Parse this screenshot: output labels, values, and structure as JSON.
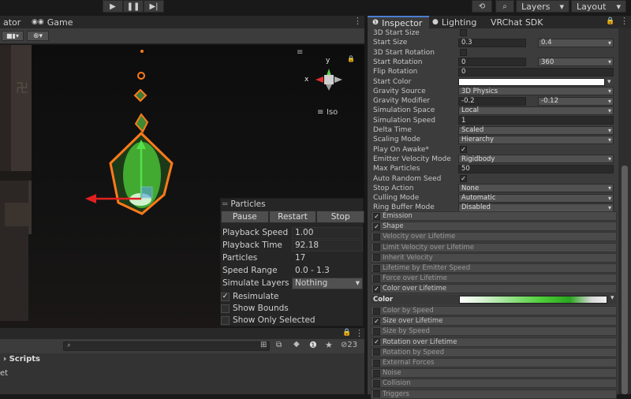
{
  "toolbar": {
    "layers_label": "Layers",
    "layout_label": "Layout"
  },
  "scene_tabs": {
    "animator": "ator",
    "game": "Game"
  },
  "gizmo": {
    "x_label": "x",
    "y_label": "y",
    "iso_label": "Iso"
  },
  "particles_overlay": {
    "title": "Particles",
    "pause": "Pause",
    "restart": "Restart",
    "stop": "Stop",
    "playback_speed_label": "Playback Speed",
    "playback_speed_value": "1.00",
    "playback_time_label": "Playback Time",
    "playback_time_value": "92.18",
    "particles_label": "Particles",
    "particles_value": "17",
    "speed_range_label": "Speed Range",
    "speed_range_value": "0.0 - 1.3",
    "simulate_layers_label": "Simulate Layers",
    "simulate_layers_value": "Nothing",
    "resimulate_label": "Resimulate",
    "show_bounds_label": "Show Bounds",
    "show_only_selected_label": "Show Only Selected"
  },
  "project": {
    "scripts_label": "Scripts",
    "asset_label": "et",
    "hidden_count": "23"
  },
  "inspector_tabs": {
    "inspector": "Inspector",
    "lighting": "Lighting",
    "vrchat": "VRChat SDK"
  },
  "properties": [
    {
      "label": "3D Start Size",
      "kind": "checkbox",
      "checked": false
    },
    {
      "label": "Start Size",
      "kind": "two",
      "a": "0.3",
      "b": "0.4"
    },
    {
      "label": "3D Start Rotation",
      "kind": "checkbox",
      "checked": false
    },
    {
      "label": "Start Rotation",
      "kind": "two",
      "a": "0",
      "b": "360"
    },
    {
      "label": "Flip Rotation",
      "kind": "field",
      "a": "0"
    },
    {
      "label": "Start Color",
      "kind": "color"
    },
    {
      "label": "Gravity Source",
      "kind": "drop",
      "a": "3D Physics"
    },
    {
      "label": "Gravity Modifier",
      "kind": "two",
      "a": "-0.2",
      "b": "-0.12"
    },
    {
      "label": "Simulation Space",
      "kind": "drop",
      "a": "Local"
    },
    {
      "label": "Simulation Speed",
      "kind": "field",
      "a": "1"
    },
    {
      "label": "Delta Time",
      "kind": "drop",
      "a": "Scaled"
    },
    {
      "label": "Scaling Mode",
      "kind": "drop",
      "a": "Hierarchy"
    },
    {
      "label": "Play On Awake*",
      "kind": "checkbox",
      "checked": true
    },
    {
      "label": "Emitter Velocity Mode",
      "kind": "drop",
      "a": "Rigidbody"
    },
    {
      "label": "Max Particles",
      "kind": "field",
      "a": "50"
    },
    {
      "label": "Auto Random Seed",
      "kind": "checkbox",
      "checked": true
    },
    {
      "label": "Stop Action",
      "kind": "drop",
      "a": "None"
    },
    {
      "label": "Culling Mode",
      "kind": "drop",
      "a": "Automatic"
    },
    {
      "label": "Ring Buffer Mode",
      "kind": "drop",
      "a": "Disabled"
    }
  ],
  "modules_a": [
    {
      "label": "Emission",
      "checked": true
    },
    {
      "label": "Shape",
      "checked": true
    },
    {
      "label": "Velocity over Lifetime",
      "checked": false
    },
    {
      "label": "Limit Velocity over Lifetime",
      "checked": false
    },
    {
      "label": "Inherit Velocity",
      "checked": false
    },
    {
      "label": "Lifetime by Emitter Speed",
      "checked": false
    },
    {
      "label": "Force over Lifetime",
      "checked": false
    },
    {
      "label": "Color over Lifetime",
      "checked": true
    }
  ],
  "color_row": {
    "label": "Color"
  },
  "modules_b": [
    {
      "label": "Color by Speed",
      "checked": false
    },
    {
      "label": "Size over Lifetime",
      "checked": true
    },
    {
      "label": "Size by Speed",
      "checked": false
    },
    {
      "label": "Rotation over Lifetime",
      "checked": true
    },
    {
      "label": "Rotation by Speed",
      "checked": false
    },
    {
      "label": "External Forces",
      "checked": false
    },
    {
      "label": "Noise",
      "checked": false
    },
    {
      "label": "Collision",
      "checked": false
    },
    {
      "label": "Triggers",
      "checked": false
    }
  ],
  "colors": {
    "accent": "#4a7fd1",
    "particle_outline": "#ff7a1a",
    "particle_green": "#4fcf3a"
  }
}
